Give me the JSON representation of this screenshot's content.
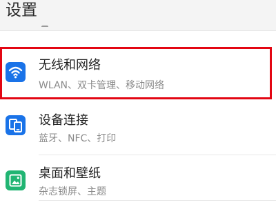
{
  "header": {
    "title": "设置"
  },
  "settings": {
    "items": [
      {
        "title": "无线和网络",
        "subtitle": "WLAN、双卡管理、移动网络",
        "icon": "wifi-icon",
        "icon_color": "#1a73e8",
        "highlighted": true
      },
      {
        "title": "设备连接",
        "subtitle": "蓝牙、NFC、打印",
        "icon": "device-connection-icon",
        "icon_color": "#1a73e8",
        "highlighted": false
      },
      {
        "title": "桌面和壁纸",
        "subtitle": "杂志锁屏、主题",
        "icon": "wallpaper-icon",
        "icon_color": "#21b573",
        "highlighted": false
      }
    ]
  },
  "colors": {
    "highlight_border": "#e30613",
    "blue_icon": "#1a73e8",
    "green_icon": "#21b573"
  }
}
